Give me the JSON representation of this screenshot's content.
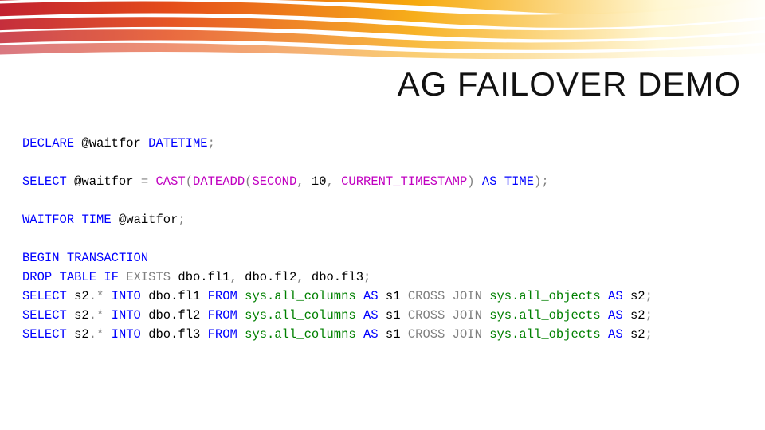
{
  "title": "AG FAILOVER DEMO",
  "code": {
    "l1": {
      "declare": "DECLARE",
      "var": "@waitfor",
      "type": "DATETIME",
      "semi": ";"
    },
    "l2": {
      "select": "SELECT",
      "var": "@waitfor",
      "eq": "=",
      "cast": "CAST",
      "lp1": "(",
      "dateadd": "DATEADD",
      "lp2": "(",
      "second": "SECOND",
      "comma1": ",",
      "n": "10",
      "comma2": ",",
      "ct": "CURRENT_TIMESTAMP",
      "rp1": ")",
      "as": "AS",
      "time": "TIME",
      "rp2": ")",
      "semi": ";"
    },
    "l3": {
      "waitfor": "WAITFOR",
      "time": "TIME",
      "var": "@waitfor",
      "semi": ";"
    },
    "l4": {
      "begin": "BEGIN",
      "tran": "TRANSACTION"
    },
    "l5": {
      "drop": "DROP",
      "table": "TABLE",
      "if": "IF",
      "exists": "EXISTS",
      "t1": "dbo.fl1",
      "c1": ",",
      "t2": "dbo.fl2",
      "c2": ",",
      "t3": "dbo.fl3",
      "semi": ";"
    },
    "l6": {
      "select": "SELECT",
      "s2": "s2",
      "dotstar": ".*",
      "into": "INTO",
      "t": "dbo.fl1",
      "from": "FROM",
      "sac": "sys.all_columns",
      "as1": "AS",
      "a1": "s1",
      "cross": "CROSS",
      "join": "JOIN",
      "sao": "sys.all_objects",
      "as2": "AS",
      "a2": "s2",
      "semi": ";"
    },
    "l7": {
      "select": "SELECT",
      "s2": "s2",
      "dotstar": ".*",
      "into": "INTO",
      "t": "dbo.fl2",
      "from": "FROM",
      "sac": "sys.all_columns",
      "as1": "AS",
      "a1": "s1",
      "cross": "CROSS",
      "join": "JOIN",
      "sao": "sys.all_objects",
      "as2": "AS",
      "a2": "s2",
      "semi": ";"
    },
    "l8": {
      "select": "SELECT",
      "s2": "s2",
      "dotstar": ".*",
      "into": "INTO",
      "t": "dbo.fl3",
      "from": "FROM",
      "sac": "sys.all_columns",
      "as1": "AS",
      "a1": "s1",
      "cross": "CROSS",
      "join": "JOIN",
      "sao": "sys.all_objects",
      "as2": "AS",
      "a2": "s2",
      "semi": ";"
    }
  }
}
